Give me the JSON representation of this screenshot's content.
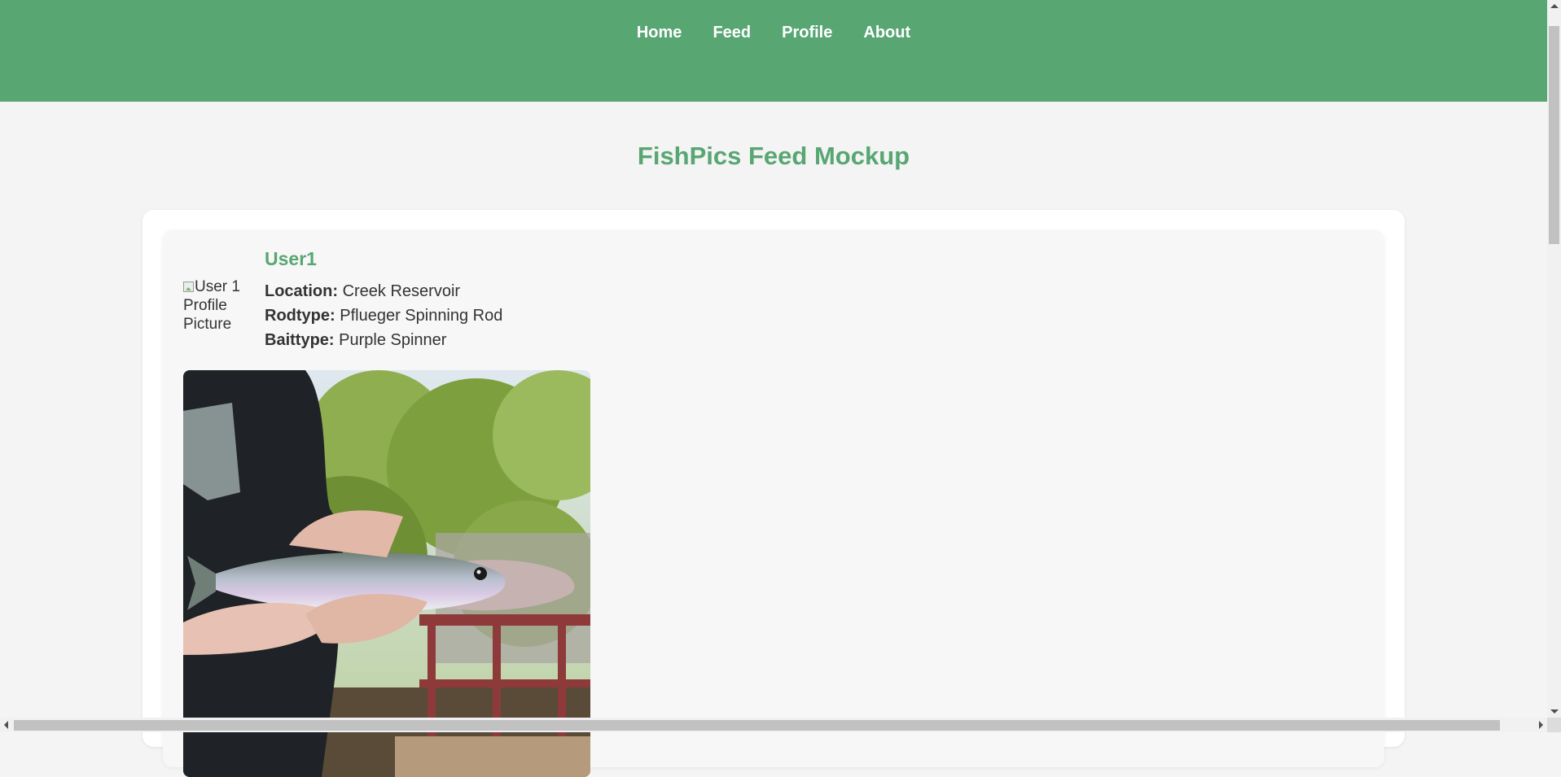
{
  "nav": {
    "links": [
      "Home",
      "Feed",
      "Profile",
      "About"
    ]
  },
  "page": {
    "title": "FishPics Feed Mockup"
  },
  "posts": [
    {
      "username": "User1",
      "avatar_alt": "User 1 Profile Picture",
      "location_label": "Location:",
      "location": "Creek Reservoir",
      "rodtype_label": "Rodtype:",
      "rodtype": "Pflueger Spinning Rod",
      "baittype_label": "Baittype:",
      "baittype": "Purple Spinner"
    }
  ],
  "colors": {
    "accent": "#58a672",
    "background": "#f4f4f4",
    "card": "#f7f7f7"
  }
}
